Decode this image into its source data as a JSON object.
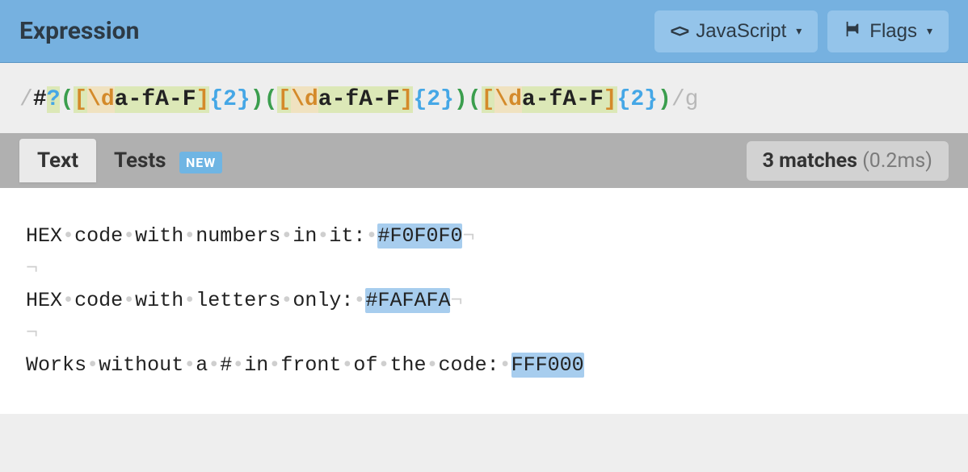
{
  "header": {
    "title": "Expression",
    "flavor_btn": {
      "label": "JavaScript",
      "caret": "▾"
    },
    "flags_btn": {
      "label": "Flags",
      "caret": "▾"
    }
  },
  "expression": {
    "open_delim": "/",
    "tokens": [
      {
        "t": "#",
        "cls": "tok-lit-hash"
      },
      {
        "t": "?",
        "cls": "tok-quant"
      },
      {
        "t": "(",
        "cls": "tok-group"
      },
      {
        "t": "[",
        "cls": "tok-set-open"
      },
      {
        "t": "\\d",
        "cls": "tok-esc"
      },
      {
        "t": "a-f",
        "cls": "tok-range"
      },
      {
        "t": "A-F",
        "cls": "tok-range"
      },
      {
        "t": "]",
        "cls": "tok-set-close"
      },
      {
        "t": "{2}",
        "cls": "tok-curly"
      },
      {
        "t": ")",
        "cls": "tok-group"
      },
      {
        "t": "(",
        "cls": "tok-group"
      },
      {
        "t": "[",
        "cls": "tok-set-open"
      },
      {
        "t": "\\d",
        "cls": "tok-esc"
      },
      {
        "t": "a-f",
        "cls": "tok-range"
      },
      {
        "t": "A-F",
        "cls": "tok-range"
      },
      {
        "t": "]",
        "cls": "tok-set-close"
      },
      {
        "t": "{2}",
        "cls": "tok-curly"
      },
      {
        "t": ")",
        "cls": "tok-group"
      },
      {
        "t": "(",
        "cls": "tok-group"
      },
      {
        "t": "[",
        "cls": "tok-set-open"
      },
      {
        "t": "\\d",
        "cls": "tok-esc"
      },
      {
        "t": "a-f",
        "cls": "tok-range"
      },
      {
        "t": "A-F",
        "cls": "tok-range"
      },
      {
        "t": "]",
        "cls": "tok-set-close"
      },
      {
        "t": "{2}",
        "cls": "tok-curly"
      },
      {
        "t": ")",
        "cls": "tok-group"
      }
    ],
    "close_delim": "/",
    "flags": "g"
  },
  "tabs": {
    "text": "Text",
    "tests": "Tests",
    "badge": "NEW"
  },
  "matches": {
    "count_label": "3 matches",
    "time_label": "(0.2ms)"
  },
  "test_text": {
    "lines": [
      {
        "prefix": "HEX code with numbers in it: ",
        "match": "#F0F0F0"
      },
      {
        "prefix": "HEX code with letters only: ",
        "match": "#FAFAFA"
      },
      {
        "prefix": "Works without a # in front of the code: ",
        "match": "FFF000"
      }
    ],
    "ws_glyph": "•",
    "eol_glyph": "¬"
  }
}
